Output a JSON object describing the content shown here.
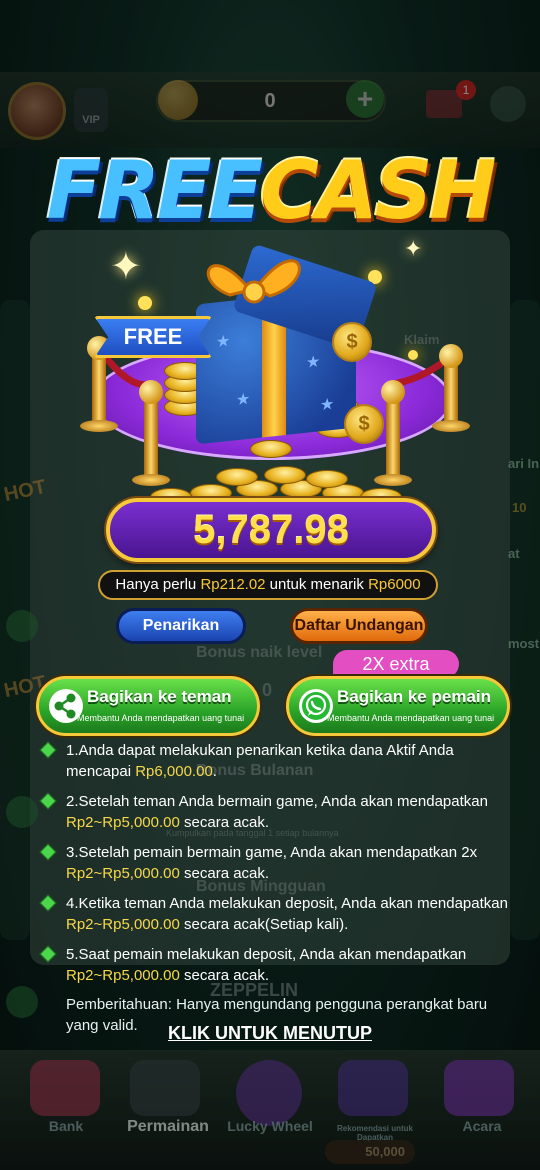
{
  "background": {
    "coin_balance": "0",
    "vip_label": "VIP",
    "mail_badge": "1",
    "side_hot": "HOT",
    "side_labels": [
      "ari In",
      "at",
      "most"
    ],
    "dim_texts": {
      "bonus_level": "Bonus naik level",
      "level_value": "0",
      "bonus_monthly": "Bonus Bulanan",
      "monthly_sub": "Kumpulkan pada tanggal 1 setiap bulannya",
      "bonus_weekly": "Bonus Mingguan",
      "claim": "Klaim",
      "zeppelin": "ZEPPELIN",
      "side_num": "10"
    },
    "nav": [
      {
        "label": "Bank"
      },
      {
        "label": "Permainan"
      },
      {
        "label": "Lucky Wheel"
      },
      {
        "label": "Rekomendasi untuk Dapatkan"
      },
      {
        "label": "Acara"
      }
    ],
    "nav_cash": "50,000"
  },
  "popup": {
    "title_part1": "FREE",
    "title_part2": "CASH",
    "free_flag": "FREE",
    "amount": "5,787.98",
    "info": {
      "prefix": "Hanya perlu ",
      "need": "Rp212.02",
      "middle": " untuk menarik ",
      "target": "Rp6000"
    },
    "withdraw_button": "Penarikan",
    "invite_list_button": "Daftar Undangan",
    "extra_tag": "2X extra",
    "share_friends": {
      "label": "Bagikan ke teman",
      "sub": "Membantu Anda mendapatkan uang tunai"
    },
    "share_players": {
      "label": "Bagikan ke pemain",
      "sub": "Membantu Anda mendapatkan uang tunai"
    },
    "rules": [
      {
        "a": "1.Anda dapat melakukan penarikan ketika dana Aktif Anda mencapai ",
        "y": "Rp6,000.00",
        "b": "."
      },
      {
        "a": "2.Setelah teman Anda bermain game, Anda akan mendapatkan ",
        "y": "Rp2~Rp5,000.00",
        "b": " secara acak."
      },
      {
        "a": "3.Setelah pemain bermain game, Anda akan mendapatkan 2x ",
        "y": "Rp2~Rp5,000.00",
        "b": " secara acak."
      },
      {
        "a": "4.Ketika teman Anda melakukan deposit, Anda akan mendapatkan ",
        "y": "Rp2~Rp5,000.00",
        "b": " secara acak(Setiap kali)."
      },
      {
        "a": "5.Saat pemain melakukan deposit, Anda akan mendapatkan ",
        "y": "Rp2~Rp5,000.00",
        "b": " secara acak."
      }
    ],
    "notice": "Pemberitahuan: Hanya mengundang pengguna perangkat baru yang valid.",
    "close_link": "KLIK UNTUK MENUTUP"
  },
  "colors": {
    "highlight_yellow": "#f6d84a",
    "gold_border": "#f6c93a",
    "purple_pill": "#7a2fd0",
    "green_button": "#2aa428",
    "pink_tag": "#e34ec2"
  },
  "icons": [
    "share-icon",
    "whatsapp-icon",
    "diamond-bullet-icon",
    "sparkle-icon",
    "gift-box-icon",
    "gold-coin-icon"
  ]
}
